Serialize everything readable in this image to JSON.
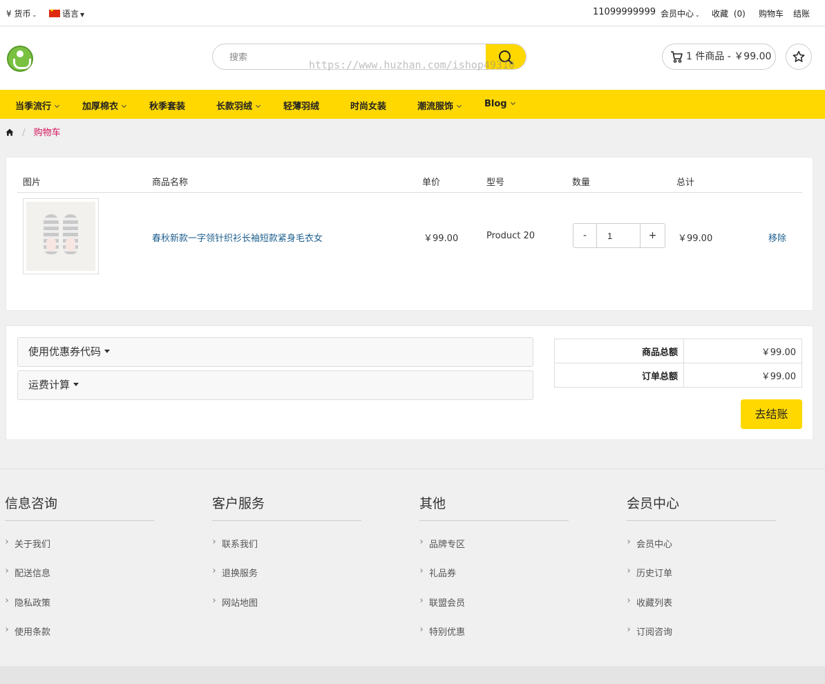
{
  "topbar": {
    "currency_symbol": "¥",
    "currency_label": "货币",
    "language_label": "语言",
    "phone": "11099999999",
    "account_label": "会员中心",
    "wishlist_label": "收藏",
    "wishlist_count": "(0)",
    "cart_label": "购物车",
    "checkout_label": "结账"
  },
  "header": {
    "search_placeholder": "搜索",
    "watermark": "https://www.huzhan.com/ishop49310",
    "cart_summary": "1 件商品 - ￥99.00"
  },
  "nav": {
    "items": [
      {
        "label": "当季流行",
        "dropdown": true
      },
      {
        "label": "加厚棉衣",
        "dropdown": true
      },
      {
        "label": "秋季套装",
        "dropdown": false
      },
      {
        "label": "长款羽绒",
        "dropdown": true
      },
      {
        "label": "轻薄羽绒",
        "dropdown": false
      },
      {
        "label": "时尚女装",
        "dropdown": false
      },
      {
        "label": "潮流服饰",
        "dropdown": true
      },
      {
        "label": "Blog",
        "dropdown": true
      }
    ]
  },
  "breadcrumb": {
    "current": "购物车"
  },
  "cart_table": {
    "headers": [
      "图片",
      "商品名称",
      "单价",
      "型号",
      "数量",
      "总计"
    ],
    "rows": [
      {
        "name": "春秋新款一字领针织衫长袖短款紧身毛衣女",
        "unit_price": "￥99.00",
        "model": "Product 20",
        "quantity": "1",
        "total": "￥99.00",
        "remove_label": "移除",
        "qty_minus": "-",
        "qty_plus": "+"
      }
    ]
  },
  "coupon": {
    "coupon_label": "使用优惠券代码",
    "shipping_label": "运费计算"
  },
  "totals": {
    "subtotal_label": "商品总额",
    "subtotal_value": "￥99.00",
    "total_label": "订单总额",
    "total_value": "￥99.00",
    "checkout_button": "去结账"
  },
  "footer": {
    "columns": [
      {
        "title": "信息咨询",
        "links": [
          "关于我们",
          "配送信息",
          "隐私政策",
          "使用条款"
        ]
      },
      {
        "title": "客户服务",
        "links": [
          "联系我们",
          "退换服务",
          "网站地图"
        ]
      },
      {
        "title": "其他",
        "links": [
          "品牌专区",
          "礼品券",
          "联盟会员",
          "特别优惠"
        ]
      },
      {
        "title": "会员中心",
        "links": [
          "会员中心",
          "历史订单",
          "收藏列表",
          "订阅咨询"
        ]
      }
    ]
  },
  "colors": {
    "accent": "#ffd800",
    "link": "#1e5f8f",
    "breadcrumb_current": "#d4145a",
    "background": "#f0f0f1"
  }
}
